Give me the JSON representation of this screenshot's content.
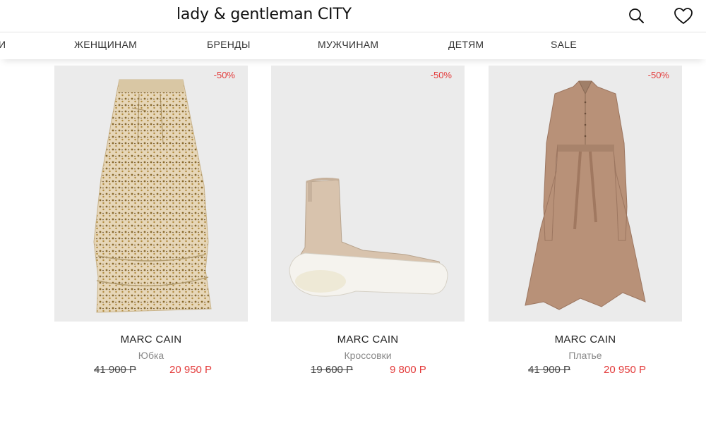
{
  "header": {
    "logo": "lady & gentleman CITY",
    "search_icon": "search-icon",
    "favorites_icon": "heart-icon"
  },
  "nav": {
    "items": [
      {
        "label": "И"
      },
      {
        "label": "ЖЕНЩИНАМ"
      },
      {
        "label": "БРЕНДЫ"
      },
      {
        "label": "МУЖЧИНАМ"
      },
      {
        "label": "ДЕТЯМ"
      },
      {
        "label": "SALE"
      }
    ]
  },
  "products": [
    {
      "discount": "-50%",
      "brand": "MARC CAIN",
      "type": "Юбка",
      "old_price": "41 900 Р",
      "new_price": "20 950 Р"
    },
    {
      "discount": "-50%",
      "brand": "MARC CAIN",
      "type": "Кроссовки",
      "old_price": "19 600 Р",
      "new_price": "9 800 Р"
    },
    {
      "discount": "-50%",
      "brand": "MARC CAIN",
      "type": "Платье",
      "old_price": "41 900 Р",
      "new_price": "20 950 Р"
    }
  ],
  "colors": {
    "accent_red": "#e33b3b",
    "image_bg": "#ebebeb",
    "text": "#222222"
  }
}
